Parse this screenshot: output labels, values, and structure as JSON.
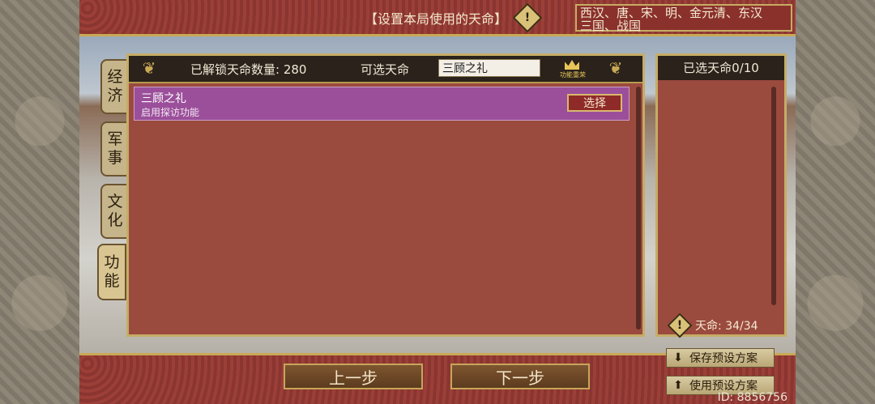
{
  "header": {
    "title": "【设置本局使用的天命】",
    "dynasties_line1": "西汉、唐、宋、明、金元清、东汉",
    "dynasties_line2": "三国、战国"
  },
  "tabs": [
    {
      "line1": "经",
      "line2": "济"
    },
    {
      "line1": "军",
      "line2": "事"
    },
    {
      "line1": "文",
      "line2": "化"
    },
    {
      "line1": "功",
      "line2": "能"
    }
  ],
  "panel": {
    "unlocked_label": "已解锁天命数量: 280",
    "available_label": "可选天命",
    "search_value": "三顾之礼",
    "crown_text": "功能重荣"
  },
  "list": [
    {
      "name": "三顾之礼",
      "desc": "启用探访功能",
      "button": "选择"
    }
  ],
  "selected_panel": {
    "title": "已选天命0/10",
    "count_label": "天命: 34/34"
  },
  "buttons": {
    "prev": "上一步",
    "next": "下一步",
    "save_preset": "保存预设方案",
    "use_preset": "使用预设方案"
  },
  "footer": {
    "id_text": "ID: 8856756"
  }
}
